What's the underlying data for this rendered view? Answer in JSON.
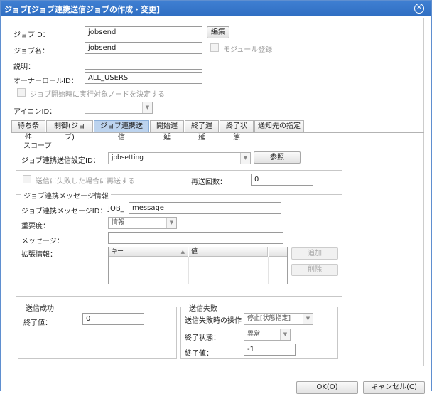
{
  "dialog": {
    "title": "ジョブ[ジョブ連携送信ジョブの作成・変更]",
    "close_glyph": "✕"
  },
  "form": {
    "job_id_label": "ジョブID：",
    "job_id_value": "jobsend",
    "edit_button": "編集",
    "job_name_label": "ジョブ名：",
    "job_name_value": "jobsend",
    "module_register_label": "モジュール登録",
    "description_label": "説明：",
    "description_value": "",
    "owner_role_label": "オーナーロールID：",
    "owner_role_value": "ALL_USERS",
    "decide_node_label": "ジョブ開始時に実行対象ノードを決定する",
    "icon_id_label": "アイコンID："
  },
  "tabs": [
    {
      "label": "待ち条件"
    },
    {
      "label": "制御(ジョブ)"
    },
    {
      "label": "ジョブ連携送信"
    },
    {
      "label": "開始遅延"
    },
    {
      "label": "終了遅延"
    },
    {
      "label": "終了状態"
    },
    {
      "label": "通知先の指定"
    }
  ],
  "scope": {
    "legend": "スコープ",
    "setting_id_label": "ジョブ連携送信設定ID：",
    "setting_id_value": "jobsetting",
    "ref_button": "参照"
  },
  "retry": {
    "resend_label": "送信に失敗した場合に再送する",
    "count_label": "再送回数：",
    "count_value": "0"
  },
  "message": {
    "legend": "ジョブ連携メッセージ情報",
    "msg_id_label": "ジョブ連携メッセージID：",
    "msg_id_prefix": "JOB_",
    "msg_id_value": "message",
    "severity_label": "重要度：",
    "severity_value": "情報",
    "message_label": "メッセージ：",
    "message_value": "",
    "ext_label": "拡張情報：",
    "col_key": "キー",
    "col_value": "値",
    "add_button": "追加",
    "delete_button": "削除"
  },
  "success": {
    "legend": "送信成功",
    "end_value_label": "終了値：",
    "end_value": "0"
  },
  "failure": {
    "legend": "送信失敗",
    "operation_label": "送信失敗時の操作",
    "operation_value": "停止[状態指定]",
    "end_state_label": "終了状態：",
    "end_state_value": "異常",
    "end_value_label": "終了値：",
    "end_value": "-1"
  },
  "footer": {
    "ok_button": "OK(O)",
    "cancel_button": "キャンセル(C)"
  }
}
